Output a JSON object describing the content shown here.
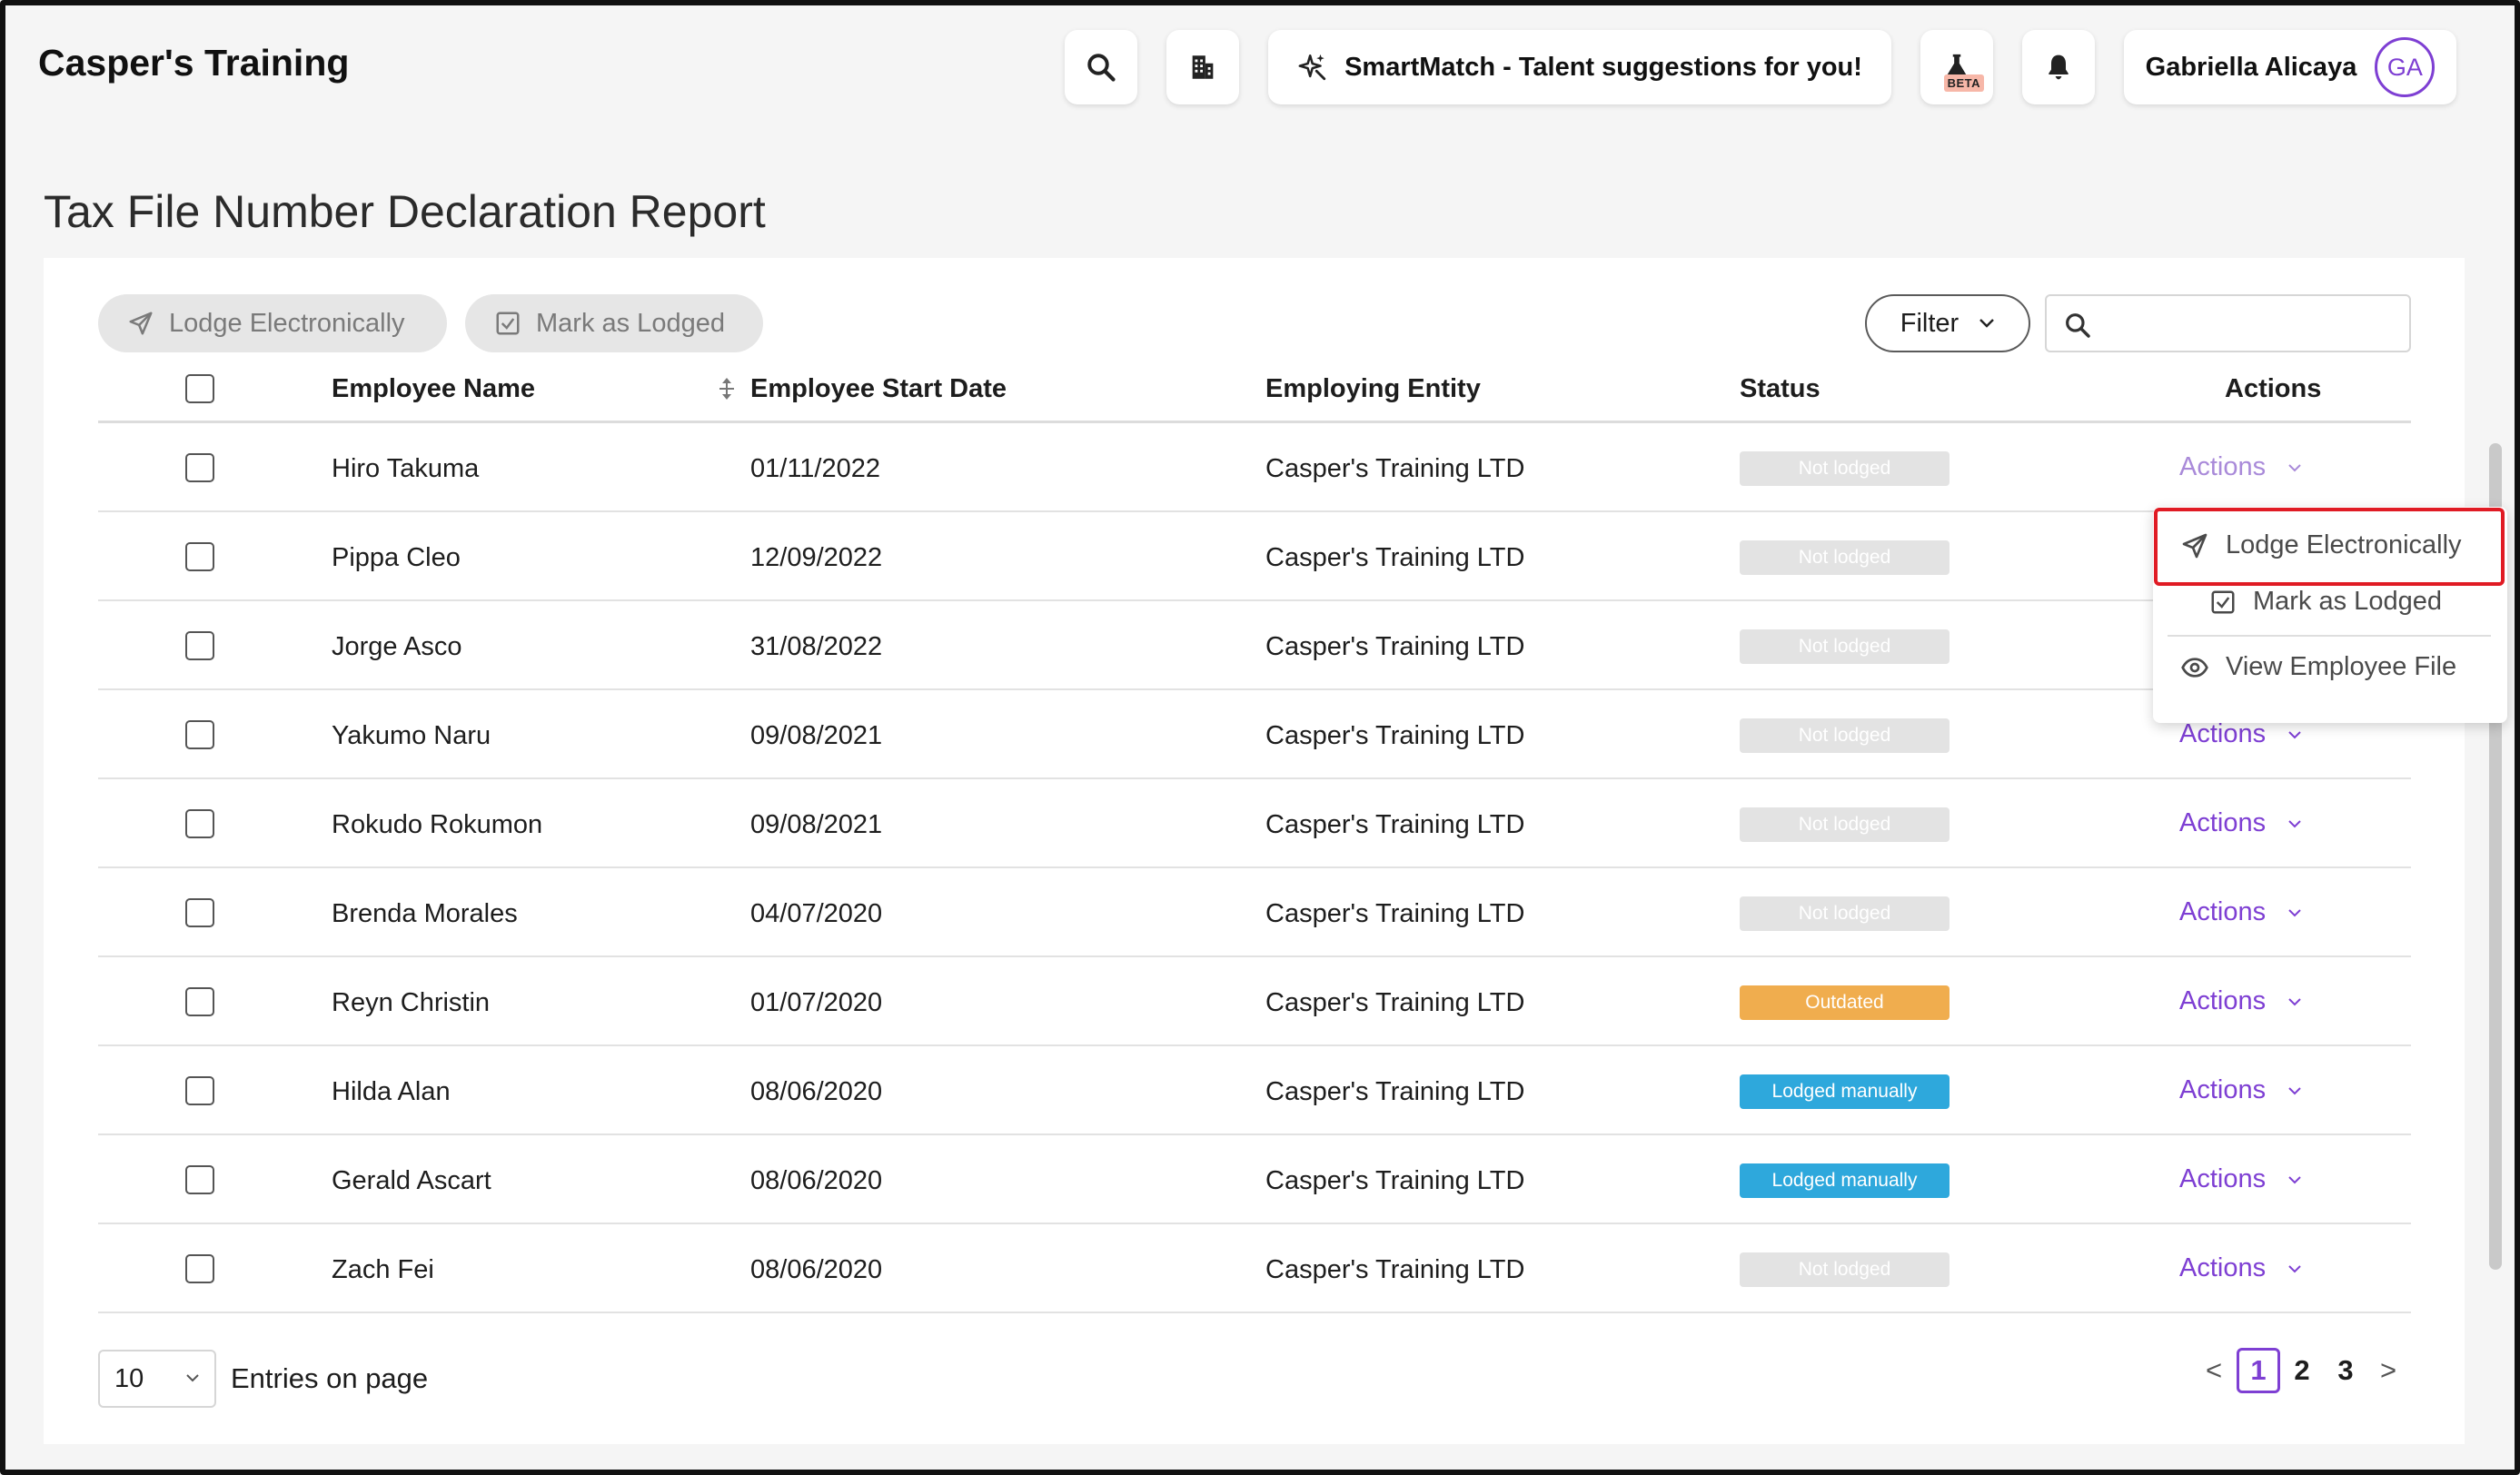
{
  "header": {
    "app_title": "Casper's Training",
    "smartmatch_label": "SmartMatch - Talent suggestions for you!",
    "beta_label": "BETA",
    "user_name": "Gabriella Alicaya",
    "user_initials": "GA",
    "icons": [
      "search-icon",
      "building-icon",
      "sparkle-icon",
      "flask-icon",
      "bell-icon"
    ]
  },
  "page": {
    "title": "Tax File Number Declaration Report"
  },
  "toolbar": {
    "lodge_label": "Lodge Electronically",
    "mark_label": "Mark as Lodged",
    "filter_label": "Filter",
    "search_value": "",
    "search_placeholder": ""
  },
  "table": {
    "columns": {
      "name": "Employee Name",
      "start_date": "Employee Start Date",
      "entity": "Employing Entity",
      "status": "Status",
      "actions": "Actions"
    },
    "rows": [
      {
        "name": "Hiro Takuma",
        "start_date": "01/11/2022",
        "entity": "Casper's Training LTD",
        "status": "Not lodged",
        "action": "Actions"
      },
      {
        "name": "Pippa Cleo",
        "start_date": "12/09/2022",
        "entity": "Casper's Training LTD",
        "status": "Not lodged",
        "action": "Actions"
      },
      {
        "name": "Jorge Asco",
        "start_date": "31/08/2022",
        "entity": "Casper's Training LTD",
        "status": "Not lodged",
        "action": "Actions"
      },
      {
        "name": "Yakumo Naru",
        "start_date": "09/08/2021",
        "entity": "Casper's Training LTD",
        "status": "Not lodged",
        "action": "Actions"
      },
      {
        "name": "Rokudo Rokumon",
        "start_date": "09/08/2021",
        "entity": "Casper's Training LTD",
        "status": "Not lodged",
        "action": "Actions"
      },
      {
        "name": "Brenda Morales",
        "start_date": "04/07/2020",
        "entity": "Casper's Training LTD",
        "status": "Not lodged",
        "action": "Actions"
      },
      {
        "name": "Reyn Christin",
        "start_date": "01/07/2020",
        "entity": "Casper's Training LTD",
        "status": "Outdated",
        "action": "Actions"
      },
      {
        "name": "Hilda Alan",
        "start_date": "08/06/2020",
        "entity": "Casper's Training LTD",
        "status": "Lodged manually",
        "action": "Actions"
      },
      {
        "name": "Gerald Ascart",
        "start_date": "08/06/2020",
        "entity": "Casper's Training LTD",
        "status": "Lodged manually",
        "action": "Actions"
      },
      {
        "name": "Zach Fei",
        "start_date": "08/06/2020",
        "entity": "Casper's Training LTD",
        "status": "Not lodged",
        "action": "Actions"
      }
    ]
  },
  "status_colors": {
    "Not lodged": "#e3e3e3",
    "Outdated": "#f0ad4e",
    "Lodged manually": "#2ea8dc"
  },
  "actions_menu": {
    "items": [
      "Lodge Electronically",
      "Mark as Lodged",
      "View Employee File"
    ]
  },
  "pagination": {
    "page_size": "10",
    "entries_label": "Entries on page",
    "pages": [
      "1",
      "2",
      "3"
    ],
    "current_page": "1",
    "prev_label": "<",
    "next_label": ">"
  },
  "colors": {
    "accent": "#7e3fd3",
    "highlight": "#e01b24"
  }
}
